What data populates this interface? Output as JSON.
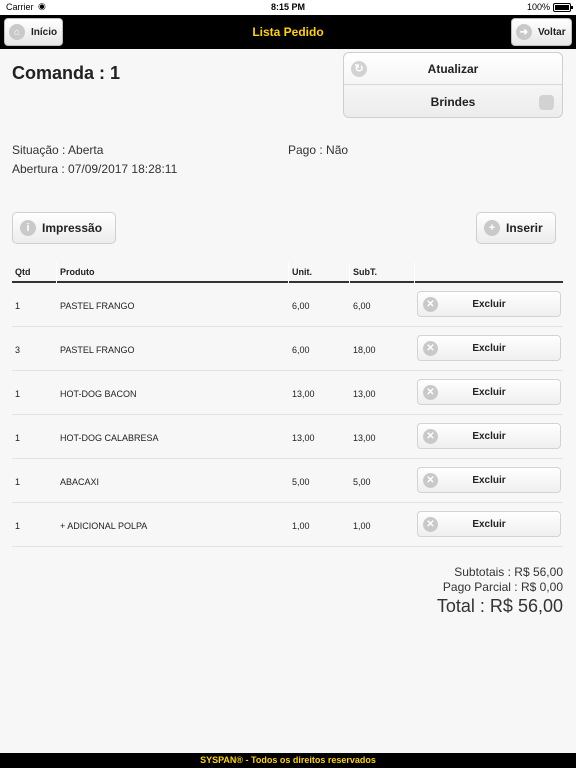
{
  "status_bar": {
    "carrier": "Carrier",
    "time": "8:15 PM",
    "battery": "100%"
  },
  "navbar": {
    "title": "Lista Pedido",
    "left_button": "Início",
    "right_button": "Voltar"
  },
  "order": {
    "title": "Comanda : 1",
    "situacao": "Situação : Aberta",
    "pago": "Pago : Não",
    "abertura": "Abertura : 07/09/2017 18:28:11"
  },
  "buttons": {
    "atualizar": "Atualizar",
    "brindes": "Brindes",
    "impressao": "Impressão",
    "inserir": "Inserir",
    "excluir": "Excluir"
  },
  "table": {
    "headers": [
      "Qtd",
      "Produto",
      "Unit.",
      "SubT."
    ],
    "rows": [
      {
        "qtd": "1",
        "produto": "PASTEL FRANGO",
        "unit": "6,00",
        "subt": "6,00"
      },
      {
        "qtd": "3",
        "produto": "PASTEL FRANGO",
        "unit": "6,00",
        "subt": "18,00"
      },
      {
        "qtd": "1",
        "produto": "HOT-DOG BACON",
        "unit": "13,00",
        "subt": "13,00"
      },
      {
        "qtd": "1",
        "produto": "HOT-DOG CALABRESA",
        "unit": "13,00",
        "subt": "13,00"
      },
      {
        "qtd": "1",
        "produto": "ABACAXI",
        "unit": "5,00",
        "subt": "5,00"
      },
      {
        "qtd": "1",
        "produto": "+ ADICIONAL POLPA",
        "unit": "1,00",
        "subt": "1,00"
      }
    ]
  },
  "totals": {
    "subtotais": "Subtotais : R$ 56,00",
    "pago_parcial": "Pago Parcial : R$ 0,00",
    "total": "Total : R$ 56,00"
  },
  "footer": {
    "text": "SYSPAN® - Todos os direitos reservados"
  },
  "colors": {
    "accent": "#ffd400",
    "bar": "#000000",
    "background": "#f7f7f7"
  }
}
